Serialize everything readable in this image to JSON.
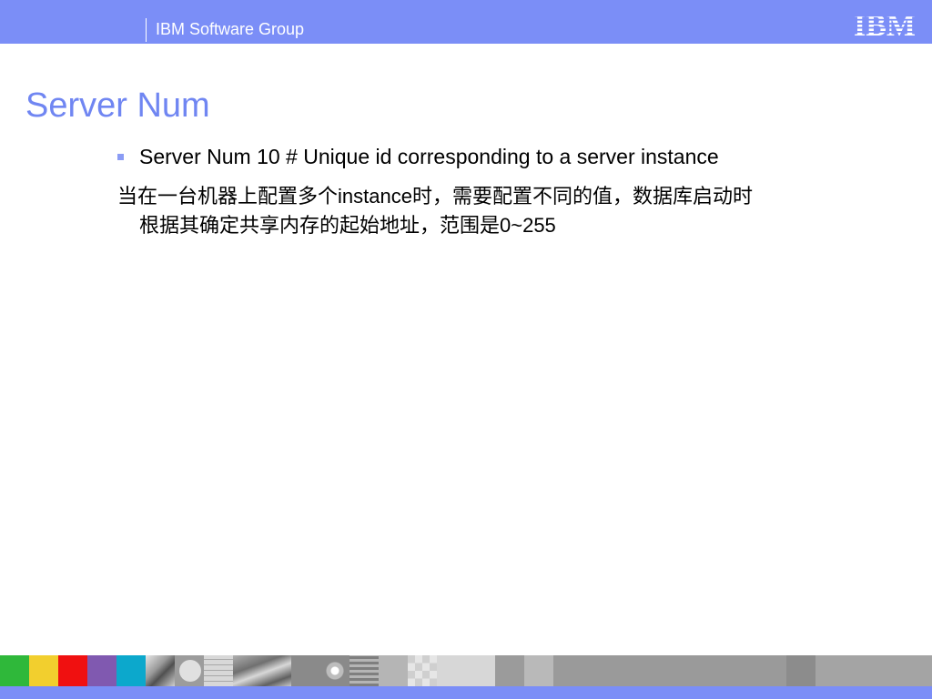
{
  "header": {
    "group_label": "IBM Software Group",
    "logo_text": "IBM"
  },
  "slide": {
    "title": "Server Num",
    "bullet": "Server Num 10   # Unique id corresponding to a server instance",
    "paragraph_line1": "当在一台机器上配置多个instance时，需要配置不同的值，数据库启动时",
    "paragraph_line2": "根据其确定共享内存的起始地址，范围是0~255"
  },
  "colors": {
    "header_bg": "#7b8ef7",
    "title": "#7086f2",
    "bullet": "#8b9cf5"
  },
  "footer_tiles": [
    "green",
    "yellow",
    "red",
    "purple",
    "cyan",
    "photo-gray",
    "circle-gray",
    "grid-gray",
    "photo-gray",
    "gray",
    "flower-gray",
    "stripes-gray",
    "light-gray",
    "checker-gray",
    "light-gray",
    "gray",
    "light-gray",
    "gray",
    "gray",
    "gray",
    "gray"
  ]
}
